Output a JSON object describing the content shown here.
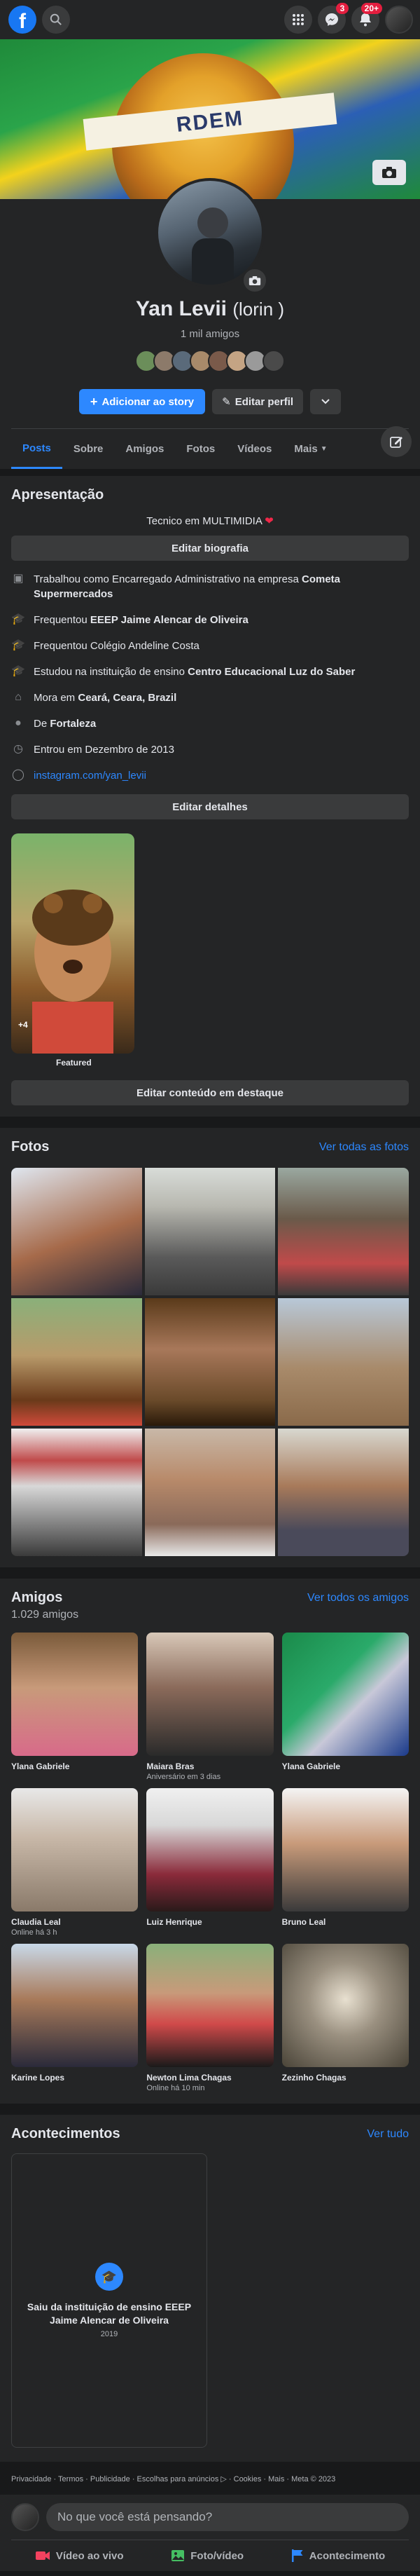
{
  "colors": {
    "accent": "#2d88ff",
    "brand": "#1877f2",
    "badge": "#e41e3f",
    "bg": "#18191a",
    "card": "#242526"
  },
  "topbar": {
    "logo_icon": "facebook-logo",
    "menu_icon": "grid-menu-icon",
    "messenger_badge": "3",
    "notifications_badge": "20+"
  },
  "profile": {
    "name": "Yan Levii",
    "alt_name": "(lorin )",
    "friends_count_label": "1 mil amigos",
    "add_story_label": "Adicionar ao story",
    "edit_profile_label": "Editar perfil"
  },
  "tabs": [
    "Posts",
    "Sobre",
    "Amigos",
    "Fotos",
    "Vídeos",
    "Mais"
  ],
  "intro": {
    "title": "Apresentação",
    "bio": "Tecnico em MULTIMIDIA",
    "edit_bio_label": "Editar biografia",
    "items": [
      {
        "icon": "briefcase-icon",
        "pre": "Trabalhou como Encarregado Administrativo na empresa ",
        "bold": "Cometa Supermercados"
      },
      {
        "icon": "graduation-cap-icon",
        "pre": "Frequentou ",
        "bold": "EEEP Jaime Alencar de Oliveira"
      },
      {
        "icon": "graduation-cap-icon",
        "pre": "Frequentou Colégio Andeline Costa",
        "bold": ""
      },
      {
        "icon": "graduation-cap-icon",
        "pre": "Estudou na instituição de ensino ",
        "bold": "Centro Educacional Luz do Saber"
      },
      {
        "icon": "home-icon",
        "pre": "Mora em ",
        "bold": "Ceará, Ceara, Brazil"
      },
      {
        "icon": "location-pin-icon",
        "pre": "De ",
        "bold": "Fortaleza"
      },
      {
        "icon": "clock-icon",
        "pre": "Entrou em Dezembro de 2013",
        "bold": ""
      },
      {
        "icon": "instagram-icon",
        "link": "instagram.com/yan_levii"
      }
    ],
    "edit_details_label": "Editar detalhes",
    "featured_count": "+4",
    "featured_label": "Featured",
    "edit_featured_label": "Editar conteúdo em destaque"
  },
  "photos": {
    "title": "Fotos",
    "see_all": "Ver todas as fotos"
  },
  "friends": {
    "title": "Amigos",
    "count": "1.029 amigos",
    "see_all": "Ver todos os amigos",
    "list": [
      {
        "name": "Ylana Gabriele",
        "sub": ""
      },
      {
        "name": "Maiara Bras",
        "sub": "Aniversário em 3 dias"
      },
      {
        "name": "Ylana Gabriele",
        "sub": ""
      },
      {
        "name": "Claudia Leal",
        "sub": "Online há 3 h"
      },
      {
        "name": "Luiz Henrique",
        "sub": ""
      },
      {
        "name": "Bruno Leal",
        "sub": ""
      },
      {
        "name": "Karine Lopes",
        "sub": ""
      },
      {
        "name": "Newton Lima Chagas",
        "sub": "Online há 10 min"
      },
      {
        "name": "Zezinho Chagas",
        "sub": ""
      }
    ]
  },
  "events": {
    "title": "Acontecimentos",
    "see_all": "Ver tudo",
    "item_title": "Saiu da instituição de ensino EEEP Jaime Alencar de Oliveira",
    "item_year": "2019"
  },
  "footer": "Privacidade · Termos · Publicidade · Escolhas para anúncios ▷ · Cookies · Mais · Meta © 2023",
  "composer": {
    "placeholder": "No que você está pensando?",
    "live": "Vídeo ao vivo",
    "photo": "Foto/vídeo",
    "event": "Acontecimento"
  },
  "cover_text": "RDEM"
}
